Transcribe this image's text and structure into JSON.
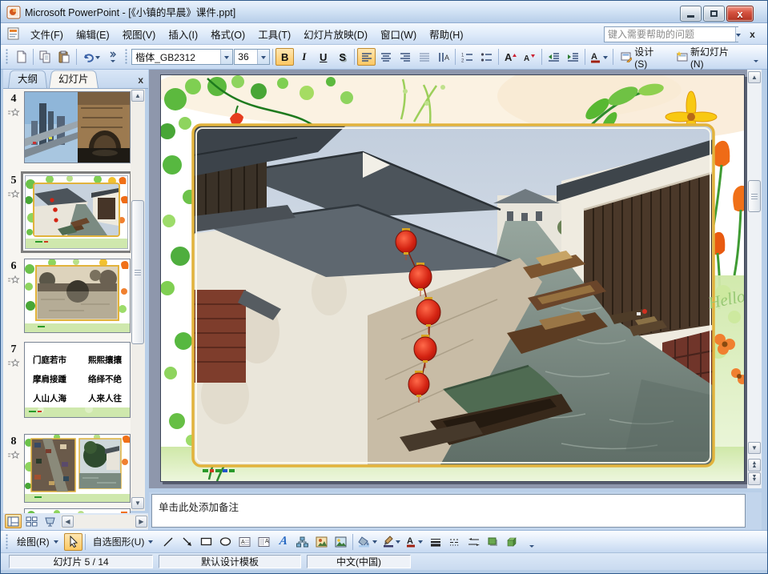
{
  "window": {
    "title": "Microsoft PowerPoint - [《小镇的早晨》课件.ppt]"
  },
  "menu_bar": {
    "items": [
      "文件(F)",
      "编辑(E)",
      "视图(V)",
      "插入(I)",
      "格式(O)",
      "工具(T)",
      "幻灯片放映(D)",
      "窗口(W)",
      "帮助(H)"
    ],
    "help_placeholder": "键入需要帮助的问题"
  },
  "formatting_toolbar": {
    "font_name": "楷体_GB2312",
    "font_size": "36",
    "bold": "B",
    "italic": "I",
    "underline": "U",
    "shadow": "S",
    "design": "设计(S)",
    "new_slide": "新幻灯片(N)"
  },
  "slides_panel": {
    "outline_tab": "大纲",
    "slides_tab": "幻灯片",
    "slides": [
      {
        "number": "4"
      },
      {
        "number": "5",
        "selected": true
      },
      {
        "number": "6"
      },
      {
        "number": "7",
        "lines": [
          "门庭若市",
          "熙熙攘攘",
          "摩肩接踵",
          "络绎不绝",
          "人山人海",
          "人来人往"
        ]
      },
      {
        "number": "8"
      }
    ]
  },
  "slide_canvas": {
    "hello_text": "Hello"
  },
  "notes_pane": {
    "placeholder": "单击此处添加备注"
  },
  "drawing_toolbar": {
    "draw": "绘图(R)",
    "autoshapes": "自选图形(U)"
  },
  "status_bar": {
    "slide_indicator": "幻灯片 5 / 14",
    "design_template": "默认设计模板",
    "language": "中文(中国)"
  },
  "colors": {
    "active_toggle": "#fcc863",
    "workspace_bg": "#8e97ac",
    "gold_frame": "#e2b33c",
    "close_button": "#d65441",
    "selected_thumb_border": "#7e7e7e"
  }
}
